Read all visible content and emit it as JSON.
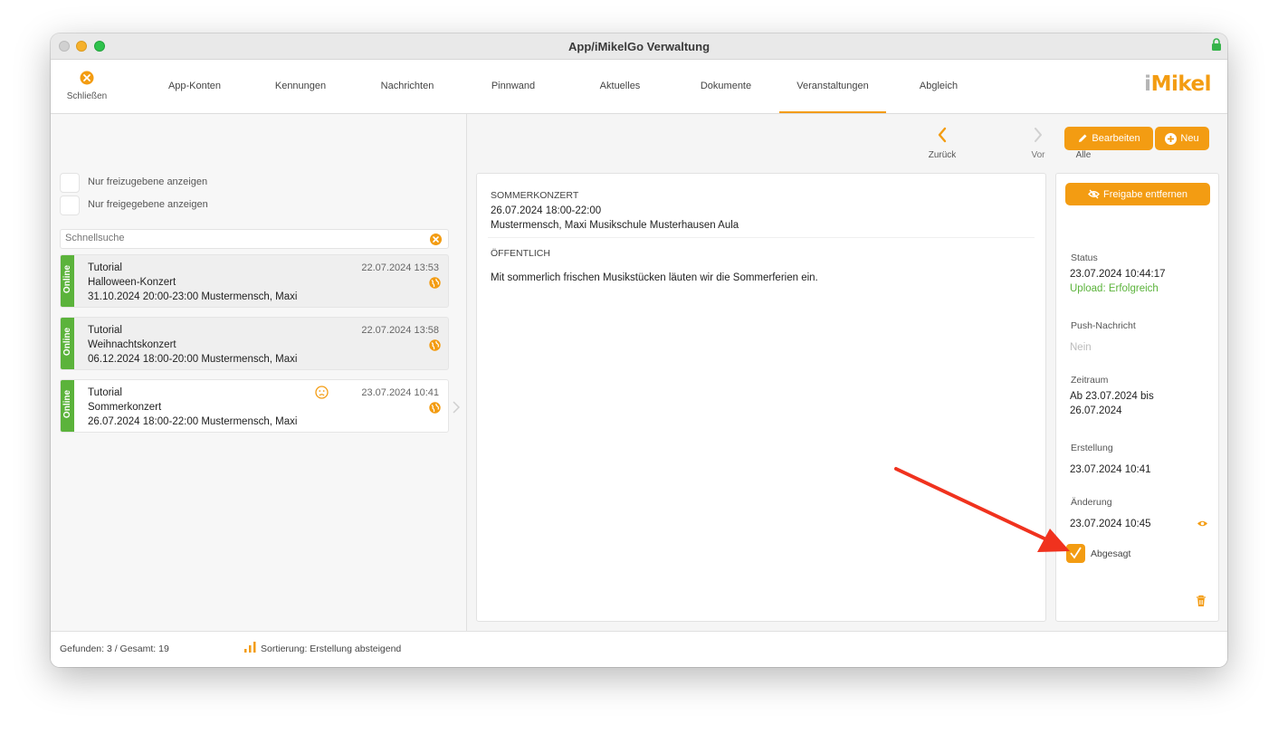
{
  "window": {
    "title": "App/iMikelGo Verwaltung"
  },
  "toolbar": {
    "close_label": "Schließen",
    "tabs": [
      "App-Konten",
      "Kennungen",
      "Nachrichten",
      "Pinnwand",
      "Aktuelles",
      "Dokumente",
      "Veranstaltungen",
      "Abgleich"
    ],
    "active_tab": "Veranstaltungen",
    "logo_i": "i",
    "logo_rest": "Mikel"
  },
  "filters": [
    {
      "label": "Nur freizugebene anzeigen",
      "checked": false
    },
    {
      "label": "Nur freigegebene anzeigen",
      "checked": false
    }
  ],
  "search": {
    "placeholder": "Schnellsuche"
  },
  "list": [
    {
      "status": "Online",
      "title": "Tutorial",
      "name": "Halloween-Konzert",
      "details": "31.10.2024 20:00-23:00 Mustermensch, Maxi",
      "date": "22.07.2024 13:53"
    },
    {
      "status": "Online",
      "title": "Tutorial",
      "name": "Weihnachtskonzert",
      "details": "06.12.2024 18:00-20:00 Mustermensch, Maxi",
      "date": "22.07.2024 13:58"
    },
    {
      "status": "Online",
      "title": "Tutorial",
      "name": "Sommerkonzert",
      "details": "26.07.2024 18:00-22:00 Mustermensch, Maxi",
      "date": "23.07.2024 10:41",
      "selected": true
    }
  ],
  "nav": {
    "back": "Zurück",
    "forward": "Vor",
    "all": "Alle"
  },
  "actions": {
    "edit": "Bearbeiten",
    "new": "Neu",
    "unpublish": "Freigabe entfernen"
  },
  "detail": {
    "kicker": "SOMMERKONZERT",
    "when": "26.07.2024 18:00-22:00",
    "where": "Mustermensch, Maxi Musikschule Musterhausen Aula",
    "visibility": "ÖFFENTLICH",
    "body": "Mit sommerlich frischen Musikstücken läuten wir die Sommerferien ein."
  },
  "side": {
    "status_caption": "Status",
    "status_time": "23.07.2024 10:44:17",
    "status_upload": "Upload: Erfolgreich",
    "push_caption": "Push-Nachricht",
    "push_value": "Nein",
    "period_caption": "Zeitraum",
    "period_line1": "Ab 23.07.2024 bis",
    "period_line2": "26.07.2024",
    "created_caption": "Erstellung",
    "created_value": "23.07.2024 10:41",
    "changed_caption": "Änderung",
    "changed_value": "23.07.2024 10:45",
    "cancelled_label": "Abgesagt",
    "cancelled_checked": true
  },
  "statusbar": {
    "found": "Gefunden: 3 / Gesamt: 19",
    "sort": "Sortierung: Erstellung absteigend"
  },
  "colors": {
    "accent": "#f39c12",
    "online": "#5bb33b",
    "annotation": "#f0321e"
  }
}
